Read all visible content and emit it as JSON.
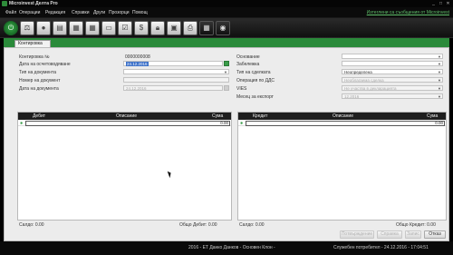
{
  "window": {
    "title": "Microinvest Делта Pro",
    "minimize": "_",
    "maximize": "□",
    "close": "✕"
  },
  "menu": {
    "items": [
      "Файл",
      "Операции",
      "Редакция",
      "Справки",
      "Други",
      "Прозорци",
      "Помощ"
    ],
    "notice": "Изтеглени са съобщения от Microinvest"
  },
  "toolbar": {
    "icons": [
      "power-icon",
      "scales-icon",
      "coins-icon",
      "ledger-icon",
      "grid-icon",
      "grid-icon",
      "document-icon",
      "checkbook-icon",
      "money-bag-icon",
      "padlock-icon",
      "register-icon",
      "printer-icon",
      "calculator-icon",
      "disc-icon"
    ]
  },
  "tab": {
    "label": "Контировка"
  },
  "form": {
    "left": {
      "number_label": "Контировка №",
      "number_value": "0000000008",
      "date_label": "Дата на осчетоводяване",
      "date_value": "24.12.2016",
      "doc_type_label": "Тип на документа",
      "doc_number_label": "Номер на документ",
      "doc_date_label": "Дата на документа",
      "doc_date_value": "24.12.2016"
    },
    "right": {
      "basis_label": "Основание",
      "note_label": "Забележка",
      "deal_type_label": "Тип на сделката",
      "deal_type_value": "Неопределена",
      "vat_op_label": "Операция по ДДС",
      "vat_op_value": "Необлагаема сделка",
      "vies_label": "VIES",
      "vies_value": "Не участва в декларацията",
      "export_month_label": "Месец за експорт",
      "export_month_value": "12.2016"
    }
  },
  "grid_left": {
    "headers": [
      "Дебит",
      "Описание",
      "Сума"
    ],
    "row_amount": "0.00",
    "footer_left": "Салдо: 0.00",
    "footer_right": "Общо Дебит: 0.00"
  },
  "grid_right": {
    "headers": [
      "Кредит",
      "Описание",
      "Сума"
    ],
    "row_amount": "0.00",
    "footer_left": "Салдо: 0.00",
    "footer_right": "Общо Кредит: 0.00"
  },
  "buttons": {
    "btn1": "Потвърждение",
    "btn2": "Справка",
    "btn3": "Запис",
    "cancel": "Отказ"
  },
  "status": {
    "center": "2016 - ЕТ Данко Данков - Основен Клон -",
    "right": "Служебен потребител - 24.12.2016 - 17:04:51"
  }
}
